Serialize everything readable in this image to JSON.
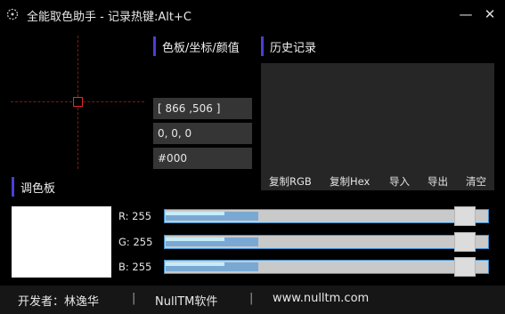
{
  "window": {
    "title": "全能取色助手  -  记录热键:Alt+C",
    "minimize_glyph": "—",
    "close_glyph": "✕"
  },
  "value_panel": {
    "title": "色板/坐标/颜值",
    "coordinates": "[ 866 ,506 ]",
    "rgb_value": "0, 0, 0",
    "hex_value": "#000"
  },
  "history": {
    "title": "历史记录",
    "buttons": [
      "复制RGB",
      "复制Hex",
      "导入",
      "导出",
      "清空"
    ]
  },
  "palette": {
    "title": "调色板",
    "swatch_color": "#ffffff",
    "channels": [
      {
        "label": "R:",
        "value": "255",
        "level": 1.0
      },
      {
        "label": "G:",
        "value": "255",
        "level": 1.0
      },
      {
        "label": "B:",
        "value": "255",
        "level": 1.0
      }
    ]
  },
  "footer": {
    "developer": "开发者：林逸华",
    "brand": "NullTM软件",
    "website": "www.nulltm.com",
    "separator": "|"
  },
  "colors": {
    "accent_bar": "#4a3fd6",
    "crosshair_center": "#e52a2a",
    "slider_border": "#3c8fd1"
  }
}
